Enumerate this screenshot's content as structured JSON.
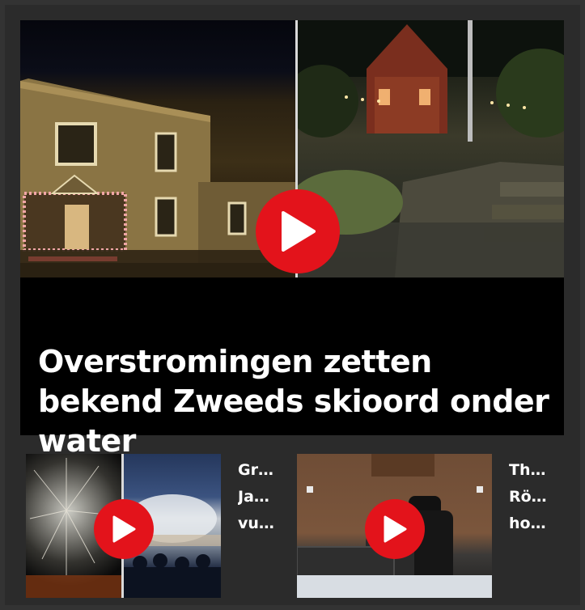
{
  "main": {
    "title": "Overstromingen zetten bekend Zweeds skioord onder water",
    "play_icon": "play-icon"
  },
  "cards": [
    {
      "title": "Gr…\nJa…\nvu…",
      "play_icon": "play-icon"
    },
    {
      "title": "Th…\nRö…\nho…",
      "play_icon": "play-icon"
    }
  ],
  "colors": {
    "background": "#333333",
    "play_button": "#e3131b",
    "text": "#ffffff",
    "title_panel": "#000000"
  }
}
